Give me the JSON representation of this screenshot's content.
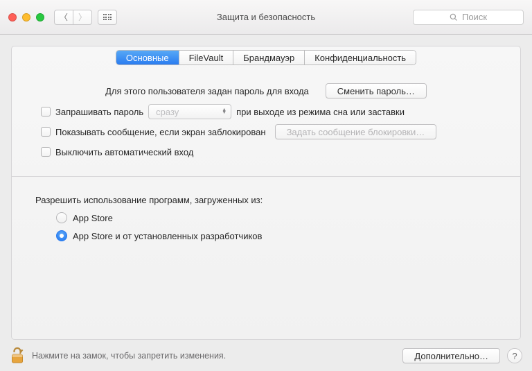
{
  "window": {
    "title": "Защита и безопасность",
    "search_placeholder": "Поиск"
  },
  "tabs": {
    "general": "Основные",
    "filevault": "FileVault",
    "firewall": "Брандмауэр",
    "privacy": "Конфиденциальность"
  },
  "password_section": {
    "prompt": "Для этого пользователя задан пароль для входа",
    "change_button": "Сменить пароль…"
  },
  "checkboxes": {
    "require_password_prefix": "Запрашивать пароль",
    "require_password_delay": "сразу",
    "require_password_suffix": "при выходе из режима сна или заставки",
    "show_message": "Показывать сообщение, если экран заблокирован",
    "set_lock_message_button": "Задать сообщение блокировки…",
    "disable_autologin": "Выключить автоматический вход"
  },
  "allow_apps": {
    "label": "Разрешить использование программ, загруженных из:",
    "opt_appstore": "App Store",
    "opt_identified": "App Store и от установленных разработчиков"
  },
  "footer": {
    "lock_text": "Нажмите на замок, чтобы запретить изменения.",
    "advanced_button": "Дополнительно…",
    "help": "?"
  }
}
